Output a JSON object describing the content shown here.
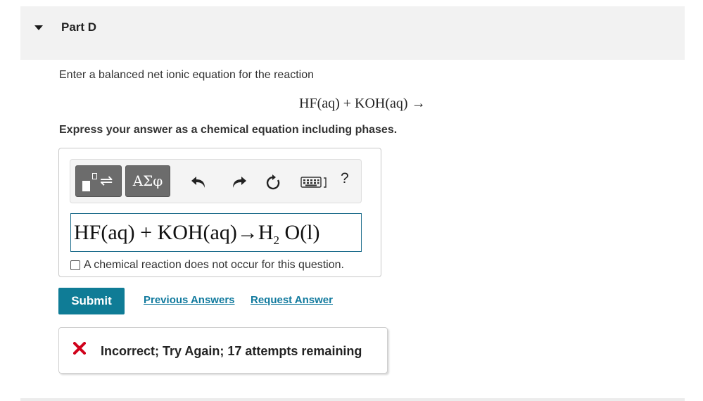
{
  "part": {
    "title": "Part D",
    "caret_icon": "caret-down-icon"
  },
  "question": {
    "prompt": "Enter a balanced net ionic equation for the reaction",
    "reaction": "HF(aq) + KOH(aq) →",
    "instruction": "Express your answer as a chemical equation including phases."
  },
  "toolbar": {
    "template_icon": "templates-reaction-icon",
    "greek_label": "ΑΣφ",
    "undo_icon": "undo-icon",
    "redo_icon": "redo-icon",
    "reset_icon": "reset-icon",
    "keyboard_icon": "keyboard-icon",
    "help_label": "?"
  },
  "answer": {
    "lhs": "HF(aq) + KOH(aq)→H",
    "subscript": "2",
    "rhs": " O(l)",
    "no_reaction_label": "A chemical reaction does not occur for this question.",
    "no_reaction_checked": false
  },
  "actions": {
    "submit_label": "Submit",
    "previous_answers_label": "Previous Answers",
    "request_answer_label": "Request Answer"
  },
  "feedback": {
    "icon": "error-x-icon",
    "text": "Incorrect; Try Again; 17 attempts remaining",
    "color": "#d0021b"
  },
  "colors": {
    "accent": "#0f7c96",
    "link": "#117a9e",
    "header_bg": "#f2f2f2"
  }
}
